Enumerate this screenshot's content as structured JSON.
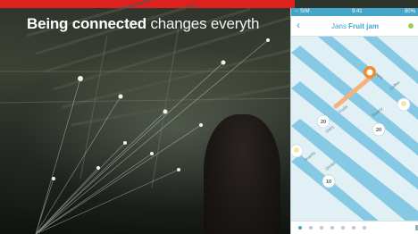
{
  "headline": {
    "bold": "Being connected",
    "rest": " changes everyth"
  },
  "phone": {
    "status": {
      "left": "◦◦ SIM",
      "center": "9:41",
      "right": "80%"
    },
    "header": {
      "title_prefix": "Jans ",
      "title_bold": "Fruit jam"
    },
    "map_labels": [
      "Jans",
      "Dairy",
      "Fruits",
      "Bakery",
      "Coffee",
      "Snacks",
      "Drinks"
    ],
    "badges": [
      "20",
      "20",
      "10"
    ],
    "page_dots": 7,
    "active_dot": 0
  },
  "colors": {
    "red_bar": "#e0201f",
    "accent": "#43a6cb",
    "highlight": "#f08c2c",
    "aisle": "#86c9e4"
  }
}
